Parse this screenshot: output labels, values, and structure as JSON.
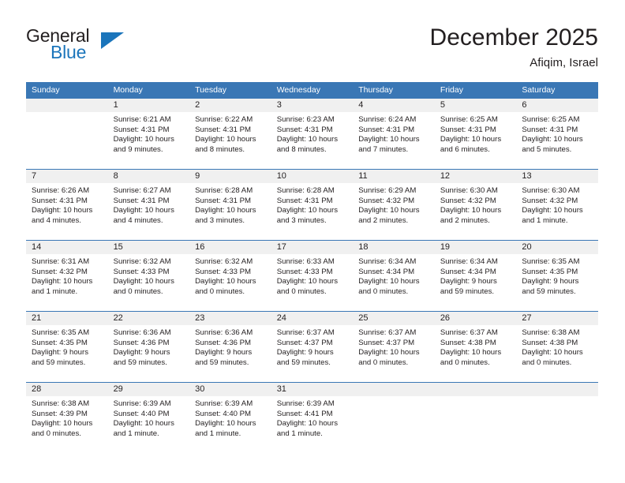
{
  "brand": {
    "name_part1": "General",
    "name_part2": "Blue",
    "triangle_color": "#1b75bb",
    "text_color": "#231f20"
  },
  "header": {
    "title": "December 2025",
    "subtitle": "Afiqim, Israel"
  },
  "theme": {
    "header_bg": "#3a77b5",
    "daynum_bg": "#f0f0f0",
    "row_divider": "#3a77b5",
    "text": "#231f20"
  },
  "weekday_headers": [
    "Sunday",
    "Monday",
    "Tuesday",
    "Wednesday",
    "Thursday",
    "Friday",
    "Saturday"
  ],
  "weeks": [
    [
      {
        "day": "",
        "sunrise": "",
        "sunset": "",
        "daylight_line1": "",
        "daylight_line2": ""
      },
      {
        "day": "1",
        "sunrise": "Sunrise: 6:21 AM",
        "sunset": "Sunset: 4:31 PM",
        "daylight_line1": "Daylight: 10 hours",
        "daylight_line2": "and 9 minutes."
      },
      {
        "day": "2",
        "sunrise": "Sunrise: 6:22 AM",
        "sunset": "Sunset: 4:31 PM",
        "daylight_line1": "Daylight: 10 hours",
        "daylight_line2": "and 8 minutes."
      },
      {
        "day": "3",
        "sunrise": "Sunrise: 6:23 AM",
        "sunset": "Sunset: 4:31 PM",
        "daylight_line1": "Daylight: 10 hours",
        "daylight_line2": "and 8 minutes."
      },
      {
        "day": "4",
        "sunrise": "Sunrise: 6:24 AM",
        "sunset": "Sunset: 4:31 PM",
        "daylight_line1": "Daylight: 10 hours",
        "daylight_line2": "and 7 minutes."
      },
      {
        "day": "5",
        "sunrise": "Sunrise: 6:25 AM",
        "sunset": "Sunset: 4:31 PM",
        "daylight_line1": "Daylight: 10 hours",
        "daylight_line2": "and 6 minutes."
      },
      {
        "day": "6",
        "sunrise": "Sunrise: 6:25 AM",
        "sunset": "Sunset: 4:31 PM",
        "daylight_line1": "Daylight: 10 hours",
        "daylight_line2": "and 5 minutes."
      }
    ],
    [
      {
        "day": "7",
        "sunrise": "Sunrise: 6:26 AM",
        "sunset": "Sunset: 4:31 PM",
        "daylight_line1": "Daylight: 10 hours",
        "daylight_line2": "and 4 minutes."
      },
      {
        "day": "8",
        "sunrise": "Sunrise: 6:27 AM",
        "sunset": "Sunset: 4:31 PM",
        "daylight_line1": "Daylight: 10 hours",
        "daylight_line2": "and 4 minutes."
      },
      {
        "day": "9",
        "sunrise": "Sunrise: 6:28 AM",
        "sunset": "Sunset: 4:31 PM",
        "daylight_line1": "Daylight: 10 hours",
        "daylight_line2": "and 3 minutes."
      },
      {
        "day": "10",
        "sunrise": "Sunrise: 6:28 AM",
        "sunset": "Sunset: 4:31 PM",
        "daylight_line1": "Daylight: 10 hours",
        "daylight_line2": "and 3 minutes."
      },
      {
        "day": "11",
        "sunrise": "Sunrise: 6:29 AM",
        "sunset": "Sunset: 4:32 PM",
        "daylight_line1": "Daylight: 10 hours",
        "daylight_line2": "and 2 minutes."
      },
      {
        "day": "12",
        "sunrise": "Sunrise: 6:30 AM",
        "sunset": "Sunset: 4:32 PM",
        "daylight_line1": "Daylight: 10 hours",
        "daylight_line2": "and 2 minutes."
      },
      {
        "day": "13",
        "sunrise": "Sunrise: 6:30 AM",
        "sunset": "Sunset: 4:32 PM",
        "daylight_line1": "Daylight: 10 hours",
        "daylight_line2": "and 1 minute."
      }
    ],
    [
      {
        "day": "14",
        "sunrise": "Sunrise: 6:31 AM",
        "sunset": "Sunset: 4:32 PM",
        "daylight_line1": "Daylight: 10 hours",
        "daylight_line2": "and 1 minute."
      },
      {
        "day": "15",
        "sunrise": "Sunrise: 6:32 AM",
        "sunset": "Sunset: 4:33 PM",
        "daylight_line1": "Daylight: 10 hours",
        "daylight_line2": "and 0 minutes."
      },
      {
        "day": "16",
        "sunrise": "Sunrise: 6:32 AM",
        "sunset": "Sunset: 4:33 PM",
        "daylight_line1": "Daylight: 10 hours",
        "daylight_line2": "and 0 minutes."
      },
      {
        "day": "17",
        "sunrise": "Sunrise: 6:33 AM",
        "sunset": "Sunset: 4:33 PM",
        "daylight_line1": "Daylight: 10 hours",
        "daylight_line2": "and 0 minutes."
      },
      {
        "day": "18",
        "sunrise": "Sunrise: 6:34 AM",
        "sunset": "Sunset: 4:34 PM",
        "daylight_line1": "Daylight: 10 hours",
        "daylight_line2": "and 0 minutes."
      },
      {
        "day": "19",
        "sunrise": "Sunrise: 6:34 AM",
        "sunset": "Sunset: 4:34 PM",
        "daylight_line1": "Daylight: 9 hours",
        "daylight_line2": "and 59 minutes."
      },
      {
        "day": "20",
        "sunrise": "Sunrise: 6:35 AM",
        "sunset": "Sunset: 4:35 PM",
        "daylight_line1": "Daylight: 9 hours",
        "daylight_line2": "and 59 minutes."
      }
    ],
    [
      {
        "day": "21",
        "sunrise": "Sunrise: 6:35 AM",
        "sunset": "Sunset: 4:35 PM",
        "daylight_line1": "Daylight: 9 hours",
        "daylight_line2": "and 59 minutes."
      },
      {
        "day": "22",
        "sunrise": "Sunrise: 6:36 AM",
        "sunset": "Sunset: 4:36 PM",
        "daylight_line1": "Daylight: 9 hours",
        "daylight_line2": "and 59 minutes."
      },
      {
        "day": "23",
        "sunrise": "Sunrise: 6:36 AM",
        "sunset": "Sunset: 4:36 PM",
        "daylight_line1": "Daylight: 9 hours",
        "daylight_line2": "and 59 minutes."
      },
      {
        "day": "24",
        "sunrise": "Sunrise: 6:37 AM",
        "sunset": "Sunset: 4:37 PM",
        "daylight_line1": "Daylight: 9 hours",
        "daylight_line2": "and 59 minutes."
      },
      {
        "day": "25",
        "sunrise": "Sunrise: 6:37 AM",
        "sunset": "Sunset: 4:37 PM",
        "daylight_line1": "Daylight: 10 hours",
        "daylight_line2": "and 0 minutes."
      },
      {
        "day": "26",
        "sunrise": "Sunrise: 6:37 AM",
        "sunset": "Sunset: 4:38 PM",
        "daylight_line1": "Daylight: 10 hours",
        "daylight_line2": "and 0 minutes."
      },
      {
        "day": "27",
        "sunrise": "Sunrise: 6:38 AM",
        "sunset": "Sunset: 4:38 PM",
        "daylight_line1": "Daylight: 10 hours",
        "daylight_line2": "and 0 minutes."
      }
    ],
    [
      {
        "day": "28",
        "sunrise": "Sunrise: 6:38 AM",
        "sunset": "Sunset: 4:39 PM",
        "daylight_line1": "Daylight: 10 hours",
        "daylight_line2": "and 0 minutes."
      },
      {
        "day": "29",
        "sunrise": "Sunrise: 6:39 AM",
        "sunset": "Sunset: 4:40 PM",
        "daylight_line1": "Daylight: 10 hours",
        "daylight_line2": "and 1 minute."
      },
      {
        "day": "30",
        "sunrise": "Sunrise: 6:39 AM",
        "sunset": "Sunset: 4:40 PM",
        "daylight_line1": "Daylight: 10 hours",
        "daylight_line2": "and 1 minute."
      },
      {
        "day": "31",
        "sunrise": "Sunrise: 6:39 AM",
        "sunset": "Sunset: 4:41 PM",
        "daylight_line1": "Daylight: 10 hours",
        "daylight_line2": "and 1 minute."
      },
      {
        "day": "",
        "sunrise": "",
        "sunset": "",
        "daylight_line1": "",
        "daylight_line2": ""
      },
      {
        "day": "",
        "sunrise": "",
        "sunset": "",
        "daylight_line1": "",
        "daylight_line2": ""
      },
      {
        "day": "",
        "sunrise": "",
        "sunset": "",
        "daylight_line1": "",
        "daylight_line2": ""
      }
    ]
  ]
}
